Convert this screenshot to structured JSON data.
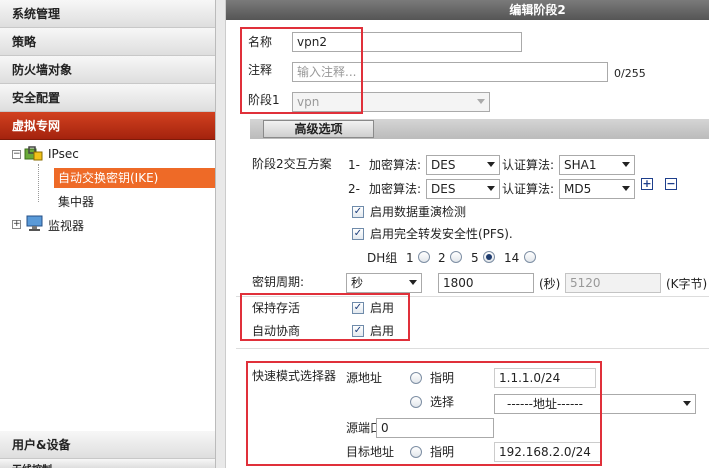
{
  "sidebar": {
    "headers": [
      "系统管理",
      "策略",
      "防火墙对象",
      "安全配置",
      "虚拟专网"
    ],
    "tree": {
      "ipsec": "IPsec",
      "ike": "自动交换密钥(IKE)",
      "concentrator": "集中器",
      "monitor": "监视器"
    },
    "bottom_header": "用户&设备",
    "bottom_partial": "无线控制"
  },
  "main": {
    "title": "编辑阶段2",
    "name_label": "名称",
    "name_value": "vpn2",
    "comment_label": "注释",
    "comment_placeholder": "输入注释...",
    "comment_counter": "0/255",
    "phase1_label": "阶段1",
    "phase1_value": "vpn",
    "advanced_button": "高级选项",
    "proposal_label": "阶段2交互方案",
    "proposals": [
      {
        "index": "1-",
        "enc_label": "加密算法:",
        "enc_value": "DES",
        "auth_label": "认证算法:",
        "auth_value": "SHA1"
      },
      {
        "index": "2-",
        "enc_label": "加密算法:",
        "enc_value": "DES",
        "auth_label": "认证算法:",
        "auth_value": "MD5"
      }
    ],
    "replay_label": "启用数据重演检测",
    "pfs_label": "启用完全转发安全性(PFS).",
    "dh_label": "DH组",
    "dh_options": [
      "1",
      "2",
      "5",
      "14"
    ],
    "dh_selected": "5",
    "keylife_label": "密钥周期:",
    "keylife_unit": "秒",
    "keylife_seconds": "1800",
    "seconds_label": "(秒)",
    "keylife_kbytes": "5120",
    "kbytes_label": "(K字节)",
    "keepalive_label": "保持存活",
    "keepalive_enable": "启用",
    "autonego_label": "自动协商",
    "autonego_enable": "启用",
    "quickmode_label": "快速模式选择器",
    "src_addr_label": "源地址",
    "specify_label": "指明",
    "src_addr_value": "1.1.1.0/24",
    "select_label": "选择",
    "addr_select_value": "------地址------",
    "src_port_label": "源端口",
    "src_port_value": "0",
    "dst_addr_label": "目标地址",
    "dst_specify_label": "指明",
    "dst_addr_value": "192.168.2.0/24"
  },
  "colors": {
    "active_nav": "#c2361a",
    "selected_item": "#ee6a27",
    "highlight_box": "#e0303a",
    "title_bar": "#666666"
  }
}
